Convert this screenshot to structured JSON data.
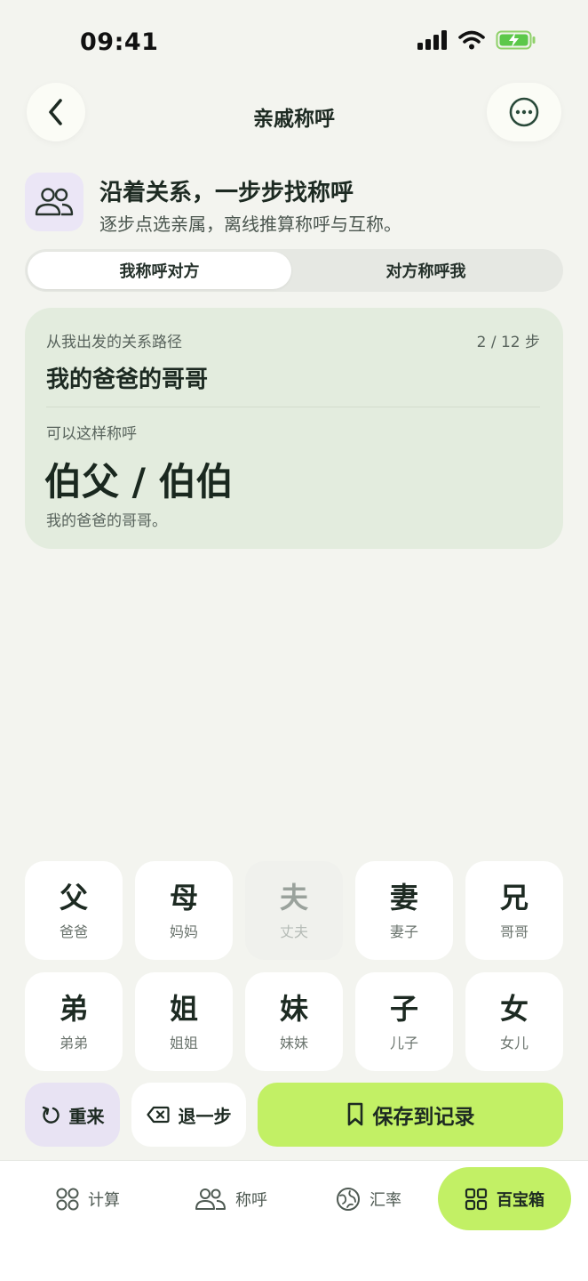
{
  "status_bar": {
    "time": "09:41"
  },
  "nav": {
    "title": "亲戚称呼",
    "back_icon": "chevron-left-icon",
    "more_icon": "more-horizontal-icon"
  },
  "intro": {
    "icon": "people-icon",
    "title": "沿着关系，一步步找称呼",
    "subtitle": "逐步点选亲属，离线推算称呼与互称。"
  },
  "segment": {
    "options": [
      "我称呼对方",
      "对方称呼我"
    ],
    "selected": "我称呼对方"
  },
  "result": {
    "path_label": "从我出发的关系路径",
    "steps": "2 / 12 步",
    "path": "我的爸爸的哥哥",
    "answer_label": "可以这样称呼",
    "answer": "伯父 / 伯伯",
    "note": "我的爸爸的哥哥。"
  },
  "keys": [
    {
      "main": "父",
      "sub": "爸爸",
      "enabled": true
    },
    {
      "main": "母",
      "sub": "妈妈",
      "enabled": true
    },
    {
      "main": "夫",
      "sub": "丈夫",
      "enabled": false
    },
    {
      "main": "妻",
      "sub": "妻子",
      "enabled": true
    },
    {
      "main": "兄",
      "sub": "哥哥",
      "enabled": true
    },
    {
      "main": "弟",
      "sub": "弟弟",
      "enabled": true
    },
    {
      "main": "姐",
      "sub": "姐姐",
      "enabled": true
    },
    {
      "main": "妹",
      "sub": "妹妹",
      "enabled": true
    },
    {
      "main": "子",
      "sub": "儿子",
      "enabled": true
    },
    {
      "main": "女",
      "sub": "女儿",
      "enabled": true
    }
  ],
  "actions": {
    "reset": "重来",
    "undo": "退一步",
    "save": "保存到记录"
  },
  "tabs": [
    {
      "label": "计算",
      "icon": "grid-circles-icon"
    },
    {
      "label": "称呼",
      "icon": "people-icon"
    },
    {
      "label": "汇率",
      "icon": "globe-exchange-icon"
    },
    {
      "label": "百宝箱",
      "icon": "grid-squares-icon",
      "active": true
    }
  ],
  "colors": {
    "accent": "#c2f065",
    "card": "#e3ecde",
    "lavender": "#e8e3f3",
    "background": "#f3f4ef"
  }
}
